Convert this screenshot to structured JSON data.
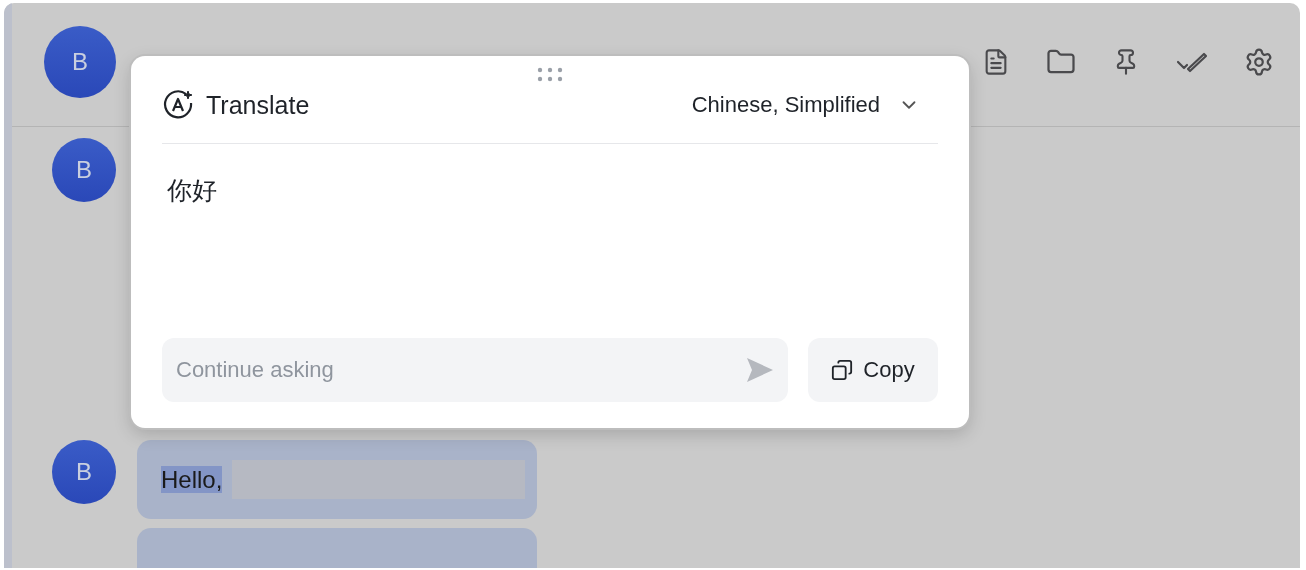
{
  "header": {
    "avatar": "B"
  },
  "messages": [
    {
      "avatar": "B"
    },
    {
      "avatar": "B",
      "bubbles": [
        {
          "kind": "text",
          "text": "Hello,",
          "highlighted": true
        },
        {
          "kind": "cut"
        }
      ]
    }
  ],
  "translate_popup": {
    "title": "Translate",
    "language": "Chinese, Simplified",
    "result": "你好",
    "input": {
      "placeholder": "Continue asking"
    },
    "copy_button": "Copy"
  }
}
